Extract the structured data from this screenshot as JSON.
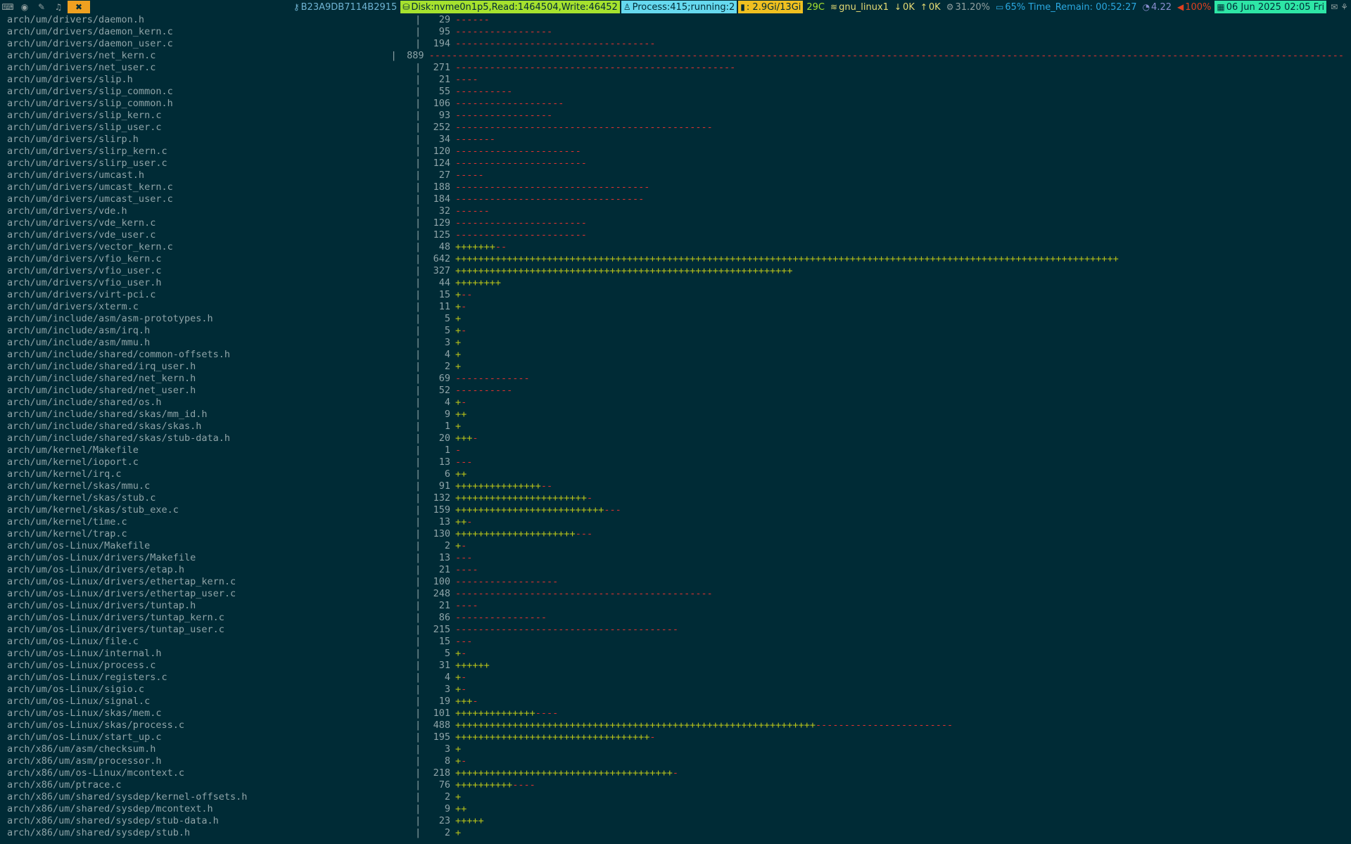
{
  "statusbar": {
    "workspaces": [
      {
        "label": "⌨",
        "icon": "terminal-icon"
      },
      {
        "label": "◉",
        "icon": "browser-icon"
      },
      {
        "label": "✎",
        "icon": "editor-icon"
      },
      {
        "label": "♫",
        "icon": "linux-icon"
      },
      {
        "label": "✖",
        "icon": "tools-icon",
        "active": true
      }
    ],
    "key_id": "B23A9DB7114B2915",
    "disk": "Disk:nvme0n1p5,Read:1464504,Write:46452",
    "process": "Process:415;running:2",
    "memory": ": 2.9Gi/13Gi",
    "temperature": "29C",
    "network_name": "gnu_linux1",
    "net_down": "0K",
    "net_up": "0K",
    "cpu": "31.20%",
    "battery": "65% Time_Remain: 00:52:27",
    "load": "4.22",
    "volume": "100%",
    "datetime": "06 Jun 2025 02:05 Fri",
    "colors": {
      "disk_bg": "#a6e22e",
      "process_bg": "#66d9ef",
      "memory_bg": "#f0c020",
      "datetime_bg": "#2ee6a6",
      "key_fg": "#6fb3d2",
      "temp_fg": "#a6e22e",
      "net_fg": "#e6db74",
      "cpu_fg": "#93a1a1",
      "battery_fg": "#2aa8e0",
      "load_fg": "#8a8fd0",
      "volume_fg": "#e04020"
    }
  },
  "diffstat": [
    {
      "path": "arch/um/drivers/daemon.h",
      "count": "29",
      "plus": 0,
      "minus": 6
    },
    {
      "path": "arch/um/drivers/daemon_kern.c",
      "count": "95",
      "plus": 0,
      "minus": 17
    },
    {
      "path": "arch/um/drivers/daemon_user.c",
      "count": "194",
      "plus": 0,
      "minus": 35
    },
    {
      "path": "arch/um/drivers/net_kern.c",
      "count": "889",
      "plus": 0,
      "minus": 160
    },
    {
      "path": "arch/um/drivers/net_user.c",
      "count": "271",
      "plus": 0,
      "minus": 49
    },
    {
      "path": "arch/um/drivers/slip.h",
      "count": "21",
      "plus": 0,
      "minus": 4
    },
    {
      "path": "arch/um/drivers/slip_common.c",
      "count": "55",
      "plus": 0,
      "minus": 10
    },
    {
      "path": "arch/um/drivers/slip_common.h",
      "count": "106",
      "plus": 0,
      "minus": 19
    },
    {
      "path": "arch/um/drivers/slip_kern.c",
      "count": "93",
      "plus": 0,
      "minus": 17
    },
    {
      "path": "arch/um/drivers/slip_user.c",
      "count": "252",
      "plus": 0,
      "minus": 45
    },
    {
      "path": "arch/um/drivers/slirp.h",
      "count": "34",
      "plus": 0,
      "minus": 7
    },
    {
      "path": "arch/um/drivers/slirp_kern.c",
      "count": "120",
      "plus": 0,
      "minus": 22
    },
    {
      "path": "arch/um/drivers/slirp_user.c",
      "count": "124",
      "plus": 0,
      "minus": 23
    },
    {
      "path": "arch/um/drivers/umcast.h",
      "count": "27",
      "plus": 0,
      "minus": 5
    },
    {
      "path": "arch/um/drivers/umcast_kern.c",
      "count": "188",
      "plus": 0,
      "minus": 34
    },
    {
      "path": "arch/um/drivers/umcast_user.c",
      "count": "184",
      "plus": 0,
      "minus": 33
    },
    {
      "path": "arch/um/drivers/vde.h",
      "count": "32",
      "plus": 0,
      "minus": 6
    },
    {
      "path": "arch/um/drivers/vde_kern.c",
      "count": "129",
      "plus": 0,
      "minus": 23
    },
    {
      "path": "arch/um/drivers/vde_user.c",
      "count": "125",
      "plus": 0,
      "minus": 23
    },
    {
      "path": "arch/um/drivers/vector_kern.c",
      "count": "48",
      "plus": 7,
      "minus": 2
    },
    {
      "path": "arch/um/drivers/vfio_kern.c",
      "count": "642",
      "plus": 116,
      "minus": 0
    },
    {
      "path": "arch/um/drivers/vfio_user.c",
      "count": "327",
      "plus": 59,
      "minus": 0
    },
    {
      "path": "arch/um/drivers/vfio_user.h",
      "count": "44",
      "plus": 8,
      "minus": 0
    },
    {
      "path": "arch/um/drivers/virt-pci.c",
      "count": "15",
      "plus": 1,
      "minus": 2
    },
    {
      "path": "arch/um/drivers/xterm.c",
      "count": "11",
      "plus": 1,
      "minus": 1
    },
    {
      "path": "arch/um/include/asm/asm-prototypes.h",
      "count": "5",
      "plus": 1,
      "minus": 0
    },
    {
      "path": "arch/um/include/asm/irq.h",
      "count": "5",
      "plus": 1,
      "minus": 1
    },
    {
      "path": "arch/um/include/asm/mmu.h",
      "count": "3",
      "plus": 1,
      "minus": 0
    },
    {
      "path": "arch/um/include/shared/common-offsets.h",
      "count": "4",
      "plus": 1,
      "minus": 0
    },
    {
      "path": "arch/um/include/shared/irq_user.h",
      "count": "2",
      "plus": 1,
      "minus": 0
    },
    {
      "path": "arch/um/include/shared/net_kern.h",
      "count": "69",
      "plus": 0,
      "minus": 13
    },
    {
      "path": "arch/um/include/shared/net_user.h",
      "count": "52",
      "plus": 0,
      "minus": 10
    },
    {
      "path": "arch/um/include/shared/os.h",
      "count": "4",
      "plus": 1,
      "minus": 1
    },
    {
      "path": "arch/um/include/shared/skas/mm_id.h",
      "count": "9",
      "plus": 2,
      "minus": 0
    },
    {
      "path": "arch/um/include/shared/skas/skas.h",
      "count": "1",
      "plus": 1,
      "minus": 0
    },
    {
      "path": "arch/um/include/shared/skas/stub-data.h",
      "count": "20",
      "plus": 3,
      "minus": 1
    },
    {
      "path": "arch/um/kernel/Makefile",
      "count": "1",
      "plus": 0,
      "minus": 1
    },
    {
      "path": "arch/um/kernel/ioport.c",
      "count": "13",
      "plus": 0,
      "minus": 3
    },
    {
      "path": "arch/um/kernel/irq.c",
      "count": "6",
      "plus": 2,
      "minus": 0
    },
    {
      "path": "arch/um/kernel/skas/mmu.c",
      "count": "91",
      "plus": 15,
      "minus": 2
    },
    {
      "path": "arch/um/kernel/skas/stub.c",
      "count": "132",
      "plus": 23,
      "minus": 1
    },
    {
      "path": "arch/um/kernel/skas/stub_exe.c",
      "count": "159",
      "plus": 26,
      "minus": 3
    },
    {
      "path": "arch/um/kernel/time.c",
      "count": "13",
      "plus": 2,
      "minus": 1
    },
    {
      "path": "arch/um/kernel/trap.c",
      "count": "130",
      "plus": 21,
      "minus": 3
    },
    {
      "path": "arch/um/os-Linux/Makefile",
      "count": "2",
      "plus": 1,
      "minus": 1
    },
    {
      "path": "arch/um/os-Linux/drivers/Makefile",
      "count": "13",
      "plus": 0,
      "minus": 3
    },
    {
      "path": "arch/um/os-Linux/drivers/etap.h",
      "count": "21",
      "plus": 0,
      "minus": 4
    },
    {
      "path": "arch/um/os-Linux/drivers/ethertap_kern.c",
      "count": "100",
      "plus": 0,
      "minus": 18
    },
    {
      "path": "arch/um/os-Linux/drivers/ethertap_user.c",
      "count": "248",
      "plus": 0,
      "minus": 45
    },
    {
      "path": "arch/um/os-Linux/drivers/tuntap.h",
      "count": "21",
      "plus": 0,
      "minus": 4
    },
    {
      "path": "arch/um/os-Linux/drivers/tuntap_kern.c",
      "count": "86",
      "plus": 0,
      "minus": 16
    },
    {
      "path": "arch/um/os-Linux/drivers/tuntap_user.c",
      "count": "215",
      "plus": 0,
      "minus": 39
    },
    {
      "path": "arch/um/os-Linux/file.c",
      "count": "15",
      "plus": 0,
      "minus": 3
    },
    {
      "path": "arch/um/os-Linux/internal.h",
      "count": "5",
      "plus": 1,
      "minus": 1
    },
    {
      "path": "arch/um/os-Linux/process.c",
      "count": "31",
      "plus": 6,
      "minus": 0
    },
    {
      "path": "arch/um/os-Linux/registers.c",
      "count": "4",
      "plus": 1,
      "minus": 1
    },
    {
      "path": "arch/um/os-Linux/sigio.c",
      "count": "3",
      "plus": 1,
      "minus": 1
    },
    {
      "path": "arch/um/os-Linux/signal.c",
      "count": "19",
      "plus": 3,
      "minus": 1
    },
    {
      "path": "arch/um/os-Linux/skas/mem.c",
      "count": "101",
      "plus": 14,
      "minus": 4
    },
    {
      "path": "arch/um/os-Linux/skas/process.c",
      "count": "488",
      "plus": 63,
      "minus": 24
    },
    {
      "path": "arch/um/os-Linux/start_up.c",
      "count": "195",
      "plus": 34,
      "minus": 1
    },
    {
      "path": "arch/x86/um/asm/checksum.h",
      "count": "3",
      "plus": 1,
      "minus": 0
    },
    {
      "path": "arch/x86/um/asm/processor.h",
      "count": "8",
      "plus": 1,
      "minus": 1
    },
    {
      "path": "arch/x86/um/os-Linux/mcontext.c",
      "count": "218",
      "plus": 38,
      "minus": 1
    },
    {
      "path": "arch/x86/um/ptrace.c",
      "count": "76",
      "plus": 10,
      "minus": 4
    },
    {
      "path": "arch/x86/um/shared/sysdep/kernel-offsets.h",
      "count": "2",
      "plus": 1,
      "minus": 0
    },
    {
      "path": "arch/x86/um/shared/sysdep/mcontext.h",
      "count": "9",
      "plus": 2,
      "minus": 0
    },
    {
      "path": "arch/x86/um/shared/sysdep/stub-data.h",
      "count": "23",
      "plus": 5,
      "minus": 0
    },
    {
      "path": "arch/x86/um/shared/sysdep/stub.h",
      "count": "2",
      "plus": 1,
      "minus": 0
    }
  ]
}
